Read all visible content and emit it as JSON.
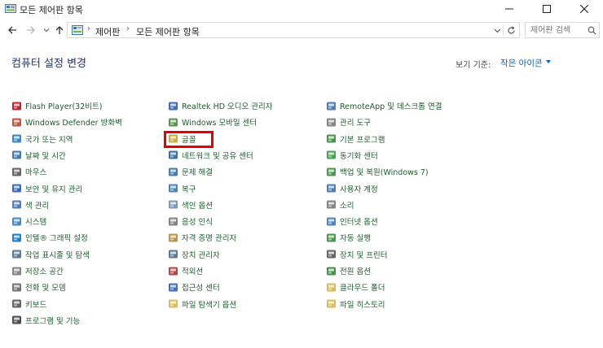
{
  "window": {
    "title": "모든 제어판 항목",
    "minimize_glyph": "—",
    "maximize_glyph": "☐",
    "close_glyph": "✕"
  },
  "nav": {
    "breadcrumb": [
      "제어판",
      "모든 제어판 항목"
    ],
    "search_placeholder": "제어판 검색"
  },
  "content": {
    "heading": "컴퓨터 설정 변경",
    "view_by_label": "보기 기준:",
    "view_by_value": "작은 아이콘"
  },
  "items": {
    "col1": [
      {
        "label": "Flash Player(32비트)",
        "icon": "flash-icon",
        "color": "#b3121b"
      },
      {
        "label": "Windows Defender 방화벽",
        "icon": "firewall-icon",
        "color": "#b4452c"
      },
      {
        "label": "국가 또는 지역",
        "icon": "globe-clock-icon",
        "color": "#2a7ab8"
      },
      {
        "label": "날짜 및 시간",
        "icon": "clock-icon",
        "color": "#2d6ea8"
      },
      {
        "label": "마우스",
        "icon": "mouse-icon",
        "color": "#555555"
      },
      {
        "label": "보안 및 유지 관리",
        "icon": "flag-icon",
        "color": "#1f5cb5"
      },
      {
        "label": "색 관리",
        "icon": "color-monitor-icon",
        "color": "#3a6fb5"
      },
      {
        "label": "시스템",
        "icon": "system-monitor-icon",
        "color": "#2f7fc1"
      },
      {
        "label": "인텔® 그래픽 설정",
        "icon": "intel-icon",
        "color": "#0a71c5"
      },
      {
        "label": "작업 표시줄 및 탐색",
        "icon": "taskbar-icon",
        "color": "#4a6a8a"
      },
      {
        "label": "저장소 공간",
        "icon": "storage-icon",
        "color": "#777777"
      },
      {
        "label": "전화 및 모뎀",
        "icon": "phone-icon",
        "color": "#666666"
      },
      {
        "label": "키보드",
        "icon": "keyboard-icon",
        "color": "#555555"
      },
      {
        "label": "프로그램 및 기능",
        "icon": "programs-icon",
        "color": "#3b3b3b"
      }
    ],
    "col2": [
      {
        "label": "Realtek HD 오디오 관리자",
        "icon": "realtek-icon",
        "color": "#2e5fa8"
      },
      {
        "label": "Windows 모바일 센터",
        "icon": "mobility-icon",
        "color": "#4a8c3b"
      },
      {
        "label": "글꼴",
        "icon": "font-icon",
        "color": "#c9a227"
      },
      {
        "label": "네트워크 및 공유 센터",
        "icon": "network-icon",
        "color": "#2c5f9e"
      },
      {
        "label": "문제 해결",
        "icon": "troubleshoot-icon",
        "color": "#2f6fa8"
      },
      {
        "label": "복구",
        "icon": "recovery-icon",
        "color": "#3778b8"
      },
      {
        "label": "색인 옵션",
        "icon": "indexing-icon",
        "color": "#6a8fb0"
      },
      {
        "label": "음성 인식",
        "icon": "microphone-icon",
        "color": "#777777"
      },
      {
        "label": "자격 증명 관리자",
        "icon": "credential-icon",
        "color": "#b08a3a"
      },
      {
        "label": "장치 관리자",
        "icon": "device-manager-icon",
        "color": "#4a6a8a"
      },
      {
        "label": "적외선",
        "icon": "infrared-icon",
        "color": "#b03030"
      },
      {
        "label": "접근성 센터",
        "icon": "accessibility-icon",
        "color": "#2a62b8"
      },
      {
        "label": "파일 탐색기 옵션",
        "icon": "folder-options-icon",
        "color": "#d8b448"
      }
    ],
    "col3": [
      {
        "label": "RemoteApp 및 데스크톱 연결",
        "icon": "remoteapp-icon",
        "color": "#3b6fb0"
      },
      {
        "label": "관리 도구",
        "icon": "admin-tools-icon",
        "color": "#777777"
      },
      {
        "label": "기본 프로그램",
        "icon": "default-programs-icon",
        "color": "#3a8a3a"
      },
      {
        "label": "동기화 센터",
        "icon": "sync-icon",
        "color": "#2f9a3a"
      },
      {
        "label": "백업 및 복원(Windows 7)",
        "icon": "backup-icon",
        "color": "#3a8a3a"
      },
      {
        "label": "사용자 계정",
        "icon": "user-accounts-icon",
        "color": "#3a6fb0"
      },
      {
        "label": "소리",
        "icon": "speaker-icon",
        "color": "#777777"
      },
      {
        "label": "인터넷 옵션",
        "icon": "internet-options-icon",
        "color": "#3a7ab8"
      },
      {
        "label": "자동 실행",
        "icon": "autoplay-icon",
        "color": "#3a8a3a"
      },
      {
        "label": "장치 및 프린터",
        "icon": "printer-icon",
        "color": "#555555"
      },
      {
        "label": "전원 옵션",
        "icon": "power-icon",
        "color": "#2f8a3a"
      },
      {
        "label": "클라우드 폴더",
        "icon": "work-folders-icon",
        "color": "#d8b448"
      },
      {
        "label": "파일 히스토리",
        "icon": "file-history-icon",
        "color": "#d8b448"
      }
    ]
  }
}
